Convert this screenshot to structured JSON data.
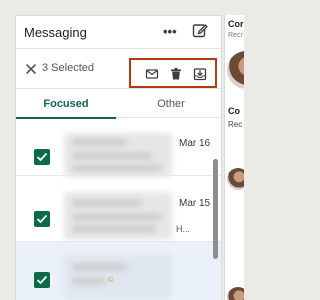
{
  "messaging": {
    "title": "Messaging",
    "more_icon": "more-horizontal-icon",
    "compose_icon": "compose-icon"
  },
  "selection": {
    "close_icon": "close-icon",
    "label": "3 Selected",
    "actions": [
      {
        "name": "mark-unread",
        "icon": "envelope-icon"
      },
      {
        "name": "delete",
        "icon": "trash-icon"
      },
      {
        "name": "archive",
        "icon": "archive-icon"
      }
    ],
    "highlight_color": "#b33b0f"
  },
  "tabs": [
    {
      "label": "Focused",
      "active": true
    },
    {
      "label": "Other",
      "active": false
    }
  ],
  "conversations": [
    {
      "date": "Mar 16",
      "selected": true
    },
    {
      "date": "Mar 15",
      "selected": true
    },
    {
      "date": "",
      "selected": true
    }
  ],
  "right_panel": {
    "title": "Cor",
    "subtitle": "Recr",
    "name": "Co",
    "role": "Rec"
  },
  "colors": {
    "accent": "#0c6a47",
    "selected_row": "#eaf1fb"
  }
}
